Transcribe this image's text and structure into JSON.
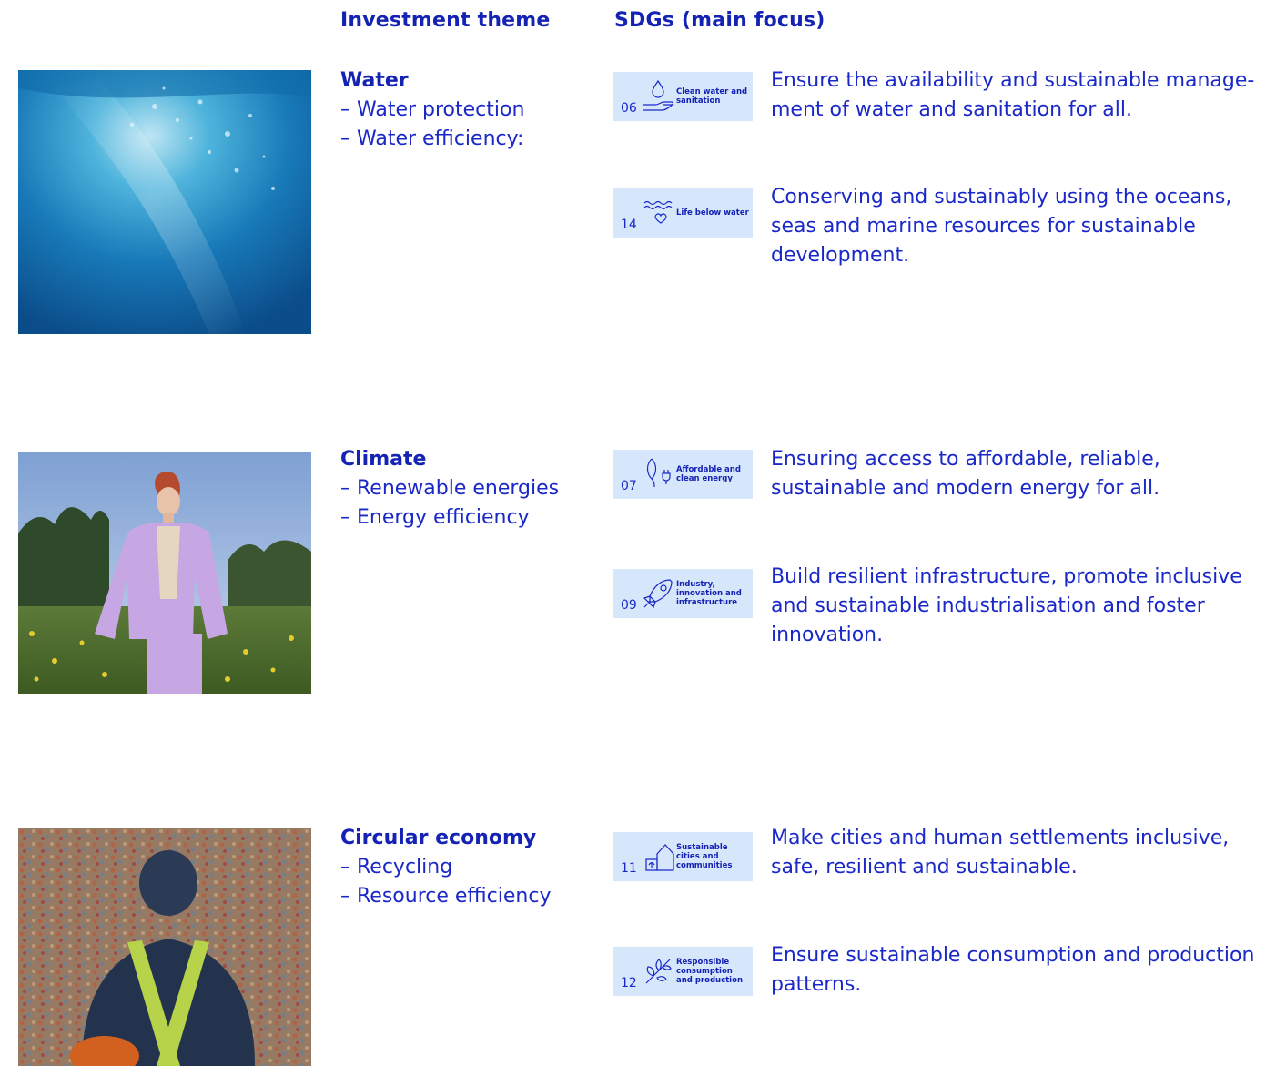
{
  "headers": {
    "theme": "Investment theme",
    "sdgs": "SDGs (main focus)"
  },
  "sections": [
    {
      "title": "Water",
      "items": [
        "– Water protection",
        "– Water efficiency:"
      ],
      "photo": "underwater-photo",
      "sdgs": [
        {
          "number": "06",
          "label": "Clean water and sanitation",
          "icon": "water-drop-hand-icon",
          "description": "Ensure the availability and sustainable manage­ment of water and sanitation for all."
        },
        {
          "number": "14",
          "label": "Life below water",
          "icon": "waves-heart-icon",
          "description": "Conserving and sustainably using the oceans, seas and marine resources for sustainable development."
        }
      ]
    },
    {
      "title": "Climate",
      "items": [
        "– Renewable energies",
        "– Energy efficiency"
      ],
      "photo": "woman-in-field-photo",
      "sdgs": [
        {
          "number": "07",
          "label": "Affordable and clean energy",
          "icon": "energy-plug-icon",
          "description": "Ensuring access to affordable, reliable, sustainable and modern energy for all."
        },
        {
          "number": "09",
          "label": "Industry, innovation and infrastructure",
          "icon": "rocket-icon",
          "description": "Build resilient infrastructure, promote inclusive and sustainable industrialisation and foster innovation."
        }
      ]
    },
    {
      "title": "Circular economy",
      "items": [
        "– Recycling",
        "– Resource efficiency"
      ],
      "photo": "recycling-worker-photo",
      "sdgs": [
        {
          "number": "11",
          "label": "Sustainable cities and communities",
          "icon": "buildings-icon",
          "description": "Make cities and human settlements inclusive, safe, resilient and sustainable."
        },
        {
          "number": "12",
          "label": "Responsible consumption and production",
          "icon": "leaf-branch-icon",
          "description": "Ensure sustainable consumption and production patterns."
        }
      ]
    }
  ]
}
